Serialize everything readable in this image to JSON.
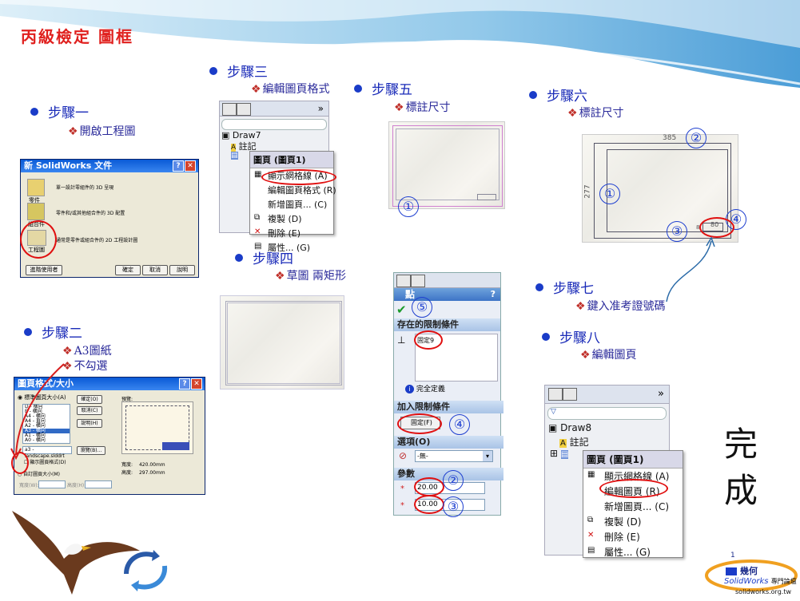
{
  "title": "丙級檢定 圖框",
  "steps": {
    "s1": {
      "label": "步驟一",
      "subs": [
        "開啟工程圖"
      ]
    },
    "s2": {
      "label": "步驟二",
      "subs": [
        "A3圖紙",
        "不勾選"
      ]
    },
    "s3": {
      "label": "步驟三",
      "subs": [
        "編輯圖頁格式"
      ]
    },
    "s4": {
      "label": "步驟四",
      "subs": [
        "草圖 兩矩形"
      ]
    },
    "s5": {
      "label": "步驟五",
      "subs": [
        "標註尺寸"
      ]
    },
    "s6": {
      "label": "步驟六",
      "subs": [
        "標註尺寸"
      ]
    },
    "s7": {
      "label": "步驟七",
      "subs": [
        "鍵入准考證號碼"
      ]
    },
    "s8": {
      "label": "步驟八",
      "subs": [
        "編輯圖頁"
      ]
    }
  },
  "done_text": "完成",
  "new_doc_dialog": {
    "title": "新 SolidWorks 文件",
    "items": [
      {
        "icon": "part-icon",
        "label": "零件",
        "desc": "單一設計零組件的 3D 呈現"
      },
      {
        "icon": "assembly-icon",
        "label": "組合件",
        "desc": "零件和/或其他組合件的 3D 配置"
      },
      {
        "icon": "drawing-icon",
        "label": "工程圖",
        "desc": "通常是零件或組合件的 2D 工程設計圖"
      }
    ],
    "advanced_button": "進階使用者",
    "ok_button": "確定",
    "cancel_button": "取消",
    "help_button": "說明"
  },
  "sheet_format_dialog": {
    "title": "圖頁格式/大小",
    "standard_radio": "標準圖頁大小(A)",
    "sizes": [
      "D - 橫向",
      "E - 橫向",
      "A4 - 橫向",
      "A4 - 直向",
      "A2 - 橫向",
      "A3 - 橫向",
      "A1 - 橫向",
      "A0 - 橫向"
    ],
    "selected_size": "A3 - 橫向",
    "format_file": "a3 - landscape.slddrt",
    "show_format_checkbox": "顯示圖頁格式(D)",
    "custom_radio": "自訂圖頁大小(M)",
    "preview_label": "預覽:",
    "width_label": "寬度:",
    "width_value": "420.00mm",
    "height_label": "高度:",
    "height_value": "297.00mm",
    "custom_width_label": "寬度(W):",
    "custom_height_label": "高度(H):",
    "ok_button": "確定(O)",
    "cancel_button": "取消(C)",
    "help_button": "說明(H)",
    "browse_button": "瀏覽(B)..."
  },
  "step3_panel": {
    "tree_root": "Draw7",
    "tree_annot": "註記",
    "tree_sheet": "圖頁1",
    "expand": "»",
    "menu_header": "圖頁 (圖頁1)",
    "menu_items": [
      "顯示網格線 (A)",
      "編輯圖頁格式 (R)",
      "新增圖頁... (C)",
      "複製 (D)",
      "刪除 (E)",
      "屬性... (G)"
    ]
  },
  "step8_panel": {
    "tree_root": "Draw8",
    "tree_annot": "註記",
    "tree_sheet": "圖頁1",
    "expand": "»",
    "menu_header": "圖頁 (圖頁1)",
    "menu_items": [
      "顯示網格線 (A)",
      "編輯圖頁 (R)",
      "新增圖頁... (C)",
      "複製 (D)",
      "刪除 (E)",
      "屬性... (G)"
    ]
  },
  "point_pm": {
    "title": "點",
    "help": "?",
    "existing_rel_header": "存在的限制條件",
    "existing_rel_item": "固定9",
    "fully_defined": "完全定義",
    "add_rel_header": "加入限制條件",
    "add_rel_item": "固定(F)",
    "options_header": "選項(O)",
    "options_value": "-無-",
    "params_header": "參數",
    "param_x": "20.00",
    "param_y": "10.00"
  },
  "step6_sheet": {
    "dim_width": "385",
    "dim_height": "277",
    "dim_box": "80",
    "dim_small": "8"
  },
  "circled_numbers": [
    "①",
    "②",
    "③",
    "④",
    "⑤"
  ],
  "footer": {
    "logo_text": "幾何",
    "brand": "SolidWorks",
    "forum": "專門論壇",
    "url": "solidworks.org.tw",
    "page_marker": "1"
  }
}
